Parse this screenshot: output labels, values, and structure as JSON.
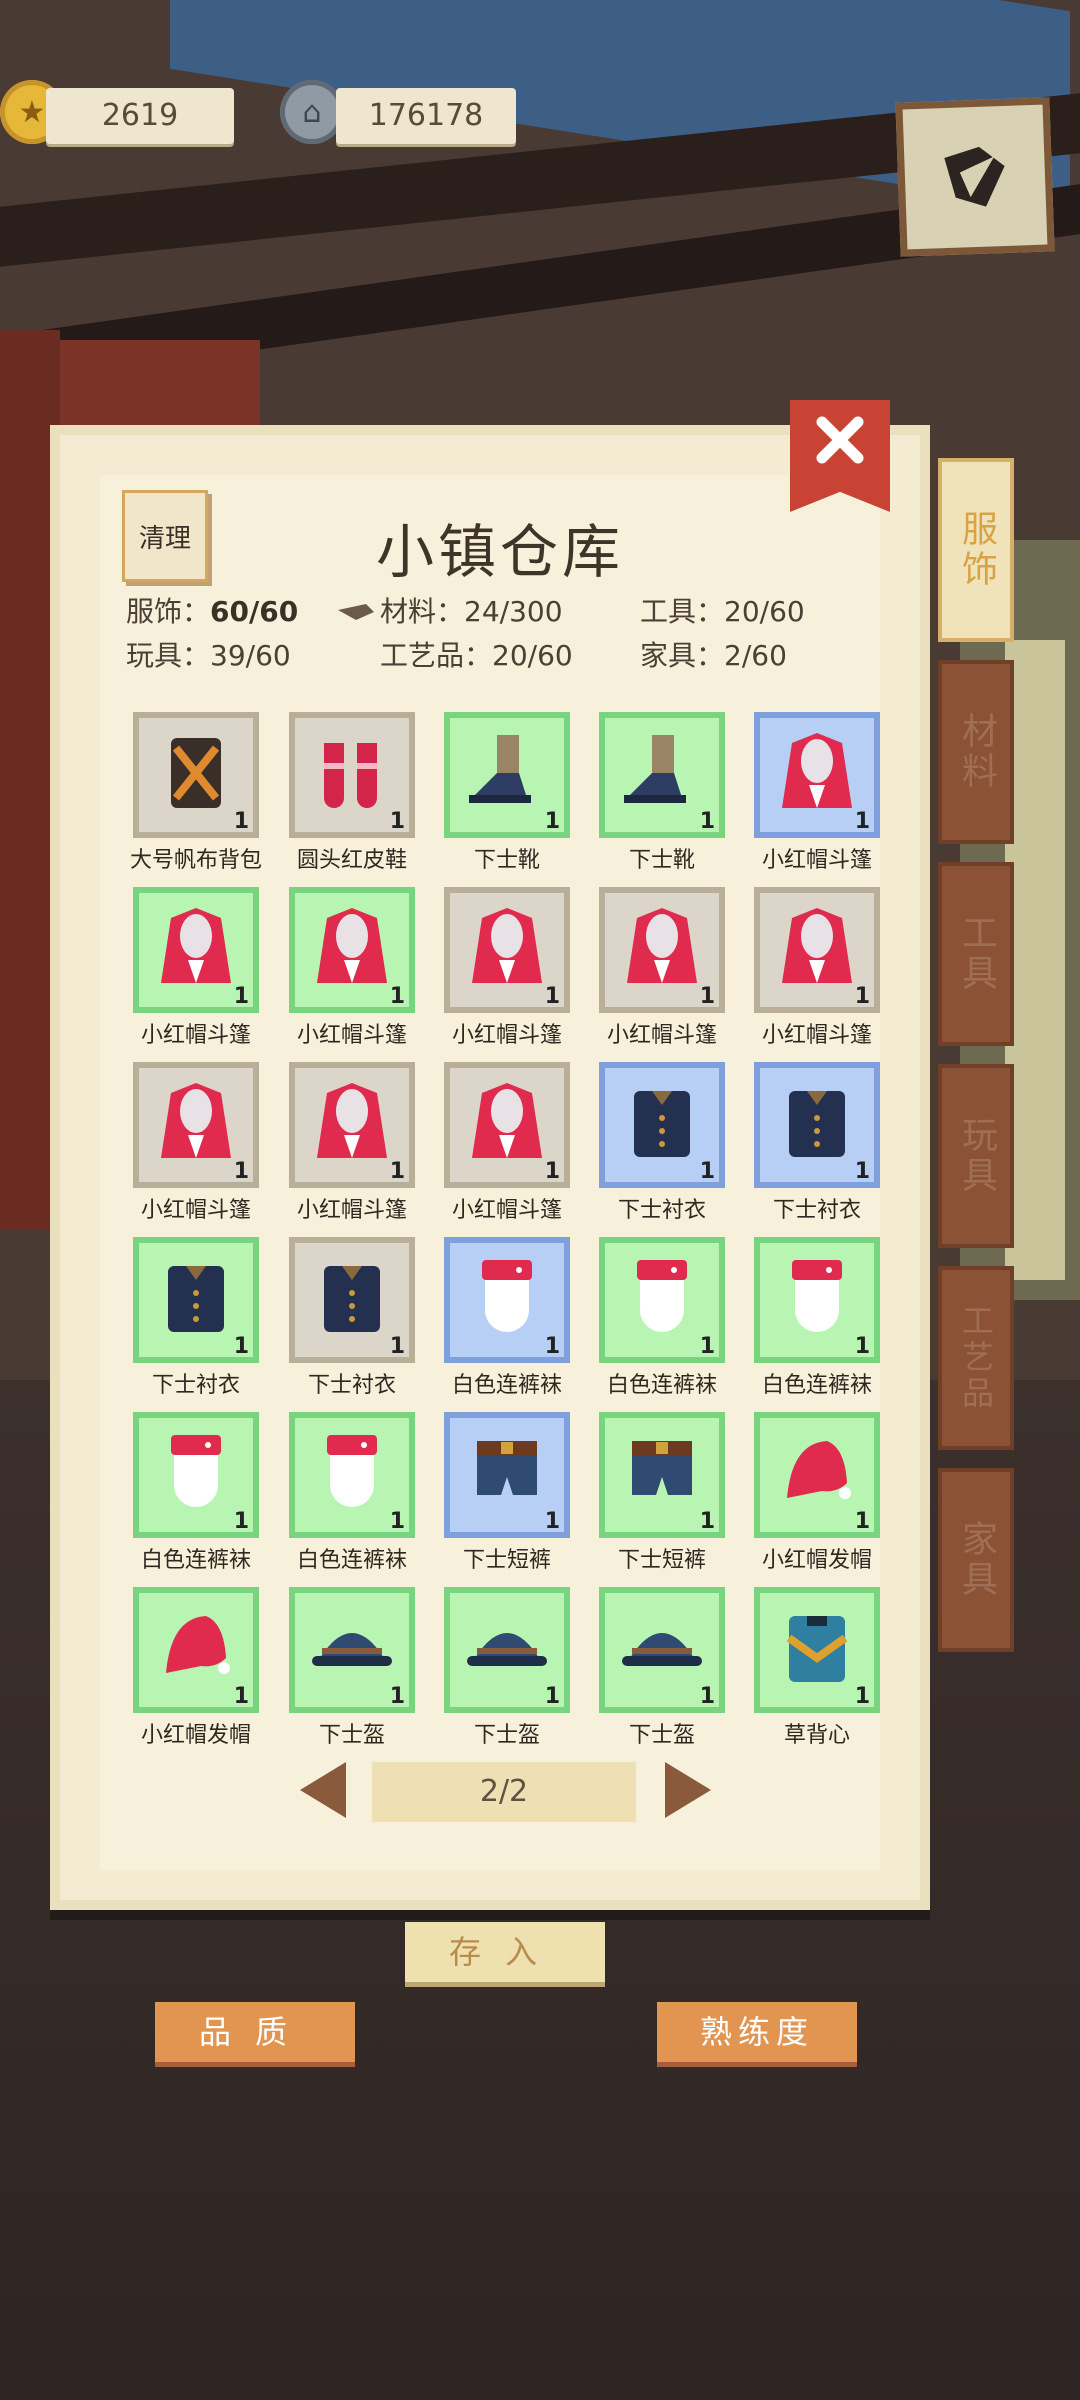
{
  "resources": {
    "coins": "2619",
    "silver": "176178"
  },
  "panel": {
    "title": "小镇仓库",
    "clean_label": "清理",
    "stats": [
      {
        "label": "服饰：",
        "value": "60/60",
        "bold": true
      },
      {
        "label": "材料：",
        "value": "24/300",
        "bold": false
      },
      {
        "label": "工具：",
        "value": "20/60",
        "bold": false
      },
      {
        "label": "玩具：",
        "value": "39/60",
        "bold": false
      },
      {
        "label": "工艺品：",
        "value": "20/60",
        "bold": false
      },
      {
        "label": "家具：",
        "value": "2/60",
        "bold": false
      }
    ],
    "page": "2/2"
  },
  "tabs": [
    {
      "label": "服饰",
      "active": true
    },
    {
      "label": "材料",
      "active": false
    },
    {
      "label": "工具",
      "active": false
    },
    {
      "label": "玩具",
      "active": false
    },
    {
      "label": "工艺品",
      "active": false
    },
    {
      "label": "家具",
      "active": false
    }
  ],
  "items": [
    {
      "name": "大号帆布背包",
      "count": "1",
      "rarity": "grey",
      "icon": "backpack"
    },
    {
      "name": "圆头红皮鞋",
      "count": "1",
      "rarity": "grey",
      "icon": "red-shoes"
    },
    {
      "name": "下士靴",
      "count": "1",
      "rarity": "green",
      "icon": "boot"
    },
    {
      "name": "下士靴",
      "count": "1",
      "rarity": "green",
      "icon": "boot"
    },
    {
      "name": "小红帽斗篷",
      "count": "1",
      "rarity": "blue",
      "icon": "red-cloak"
    },
    {
      "name": "小红帽斗篷",
      "count": "1",
      "rarity": "green",
      "icon": "red-cloak"
    },
    {
      "name": "小红帽斗篷",
      "count": "1",
      "rarity": "green",
      "icon": "red-cloak"
    },
    {
      "name": "小红帽斗篷",
      "count": "1",
      "rarity": "grey",
      "icon": "red-cloak"
    },
    {
      "name": "小红帽斗篷",
      "count": "1",
      "rarity": "grey",
      "icon": "red-cloak"
    },
    {
      "name": "小红帽斗篷",
      "count": "1",
      "rarity": "grey",
      "icon": "red-cloak"
    },
    {
      "name": "小红帽斗篷",
      "count": "1",
      "rarity": "grey",
      "icon": "red-cloak"
    },
    {
      "name": "小红帽斗篷",
      "count": "1",
      "rarity": "grey",
      "icon": "red-cloak"
    },
    {
      "name": "小红帽斗篷",
      "count": "1",
      "rarity": "grey",
      "icon": "red-cloak"
    },
    {
      "name": "下士衬衣",
      "count": "1",
      "rarity": "blue",
      "icon": "shirt"
    },
    {
      "name": "下士衬衣",
      "count": "1",
      "rarity": "blue",
      "icon": "shirt"
    },
    {
      "name": "下士衬衣",
      "count": "1",
      "rarity": "green",
      "icon": "shirt"
    },
    {
      "name": "下士衬衣",
      "count": "1",
      "rarity": "grey",
      "icon": "shirt"
    },
    {
      "name": "白色连裤袜",
      "count": "1",
      "rarity": "blue",
      "icon": "tights"
    },
    {
      "name": "白色连裤袜",
      "count": "1",
      "rarity": "green",
      "icon": "tights"
    },
    {
      "name": "白色连裤袜",
      "count": "1",
      "rarity": "green",
      "icon": "tights"
    },
    {
      "name": "白色连裤袜",
      "count": "1",
      "rarity": "green",
      "icon": "tights"
    },
    {
      "name": "白色连裤袜",
      "count": "1",
      "rarity": "green",
      "icon": "tights"
    },
    {
      "name": "下士短裤",
      "count": "1",
      "rarity": "blue",
      "icon": "shorts"
    },
    {
      "name": "下士短裤",
      "count": "1",
      "rarity": "green",
      "icon": "shorts"
    },
    {
      "name": "小红帽发帽",
      "count": "1",
      "rarity": "green",
      "icon": "red-hood"
    },
    {
      "name": "小红帽发帽",
      "count": "1",
      "rarity": "green",
      "icon": "red-hood"
    },
    {
      "name": "下士盔",
      "count": "1",
      "rarity": "green",
      "icon": "helmet"
    },
    {
      "name": "下士盔",
      "count": "1",
      "rarity": "green",
      "icon": "helmet"
    },
    {
      "name": "下士盔",
      "count": "1",
      "rarity": "green",
      "icon": "helmet"
    },
    {
      "name": "草背心",
      "count": "1",
      "rarity": "green",
      "icon": "vest"
    }
  ],
  "buttons": {
    "store": "存入",
    "quality": "品质",
    "proficiency": "熟练度"
  }
}
